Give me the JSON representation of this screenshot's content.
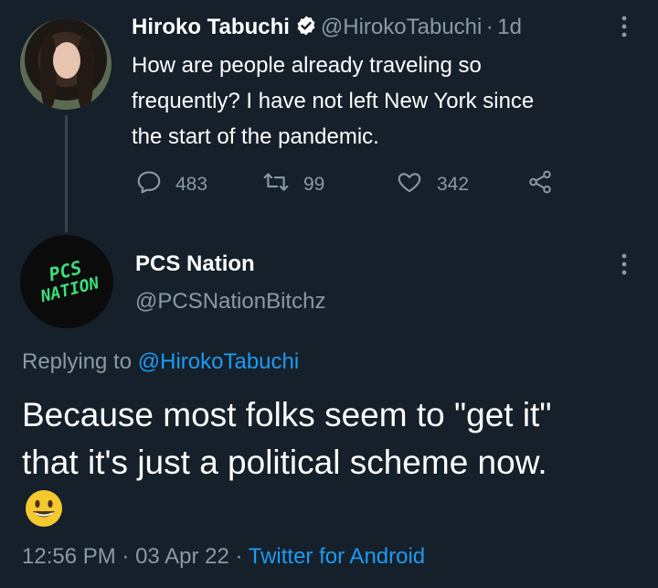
{
  "parent_tweet": {
    "display_name": "Hiroko Tabuchi",
    "handle": "@HirokoTabuchi",
    "separator": "·",
    "time_ago": "1d",
    "text_lines": [
      "How are people already traveling so",
      "frequently? I have not left New York since",
      "the start of the pandemic."
    ],
    "replies": "483",
    "retweets": "99",
    "likes": "342",
    "icons": [
      "verified-badge-icon",
      "reply-icon",
      "retweet-icon",
      "like-icon",
      "share-icon",
      "more-icon"
    ]
  },
  "reply_tweet": {
    "display_name": "PCS Nation",
    "handle": "@PCSNationBitchz",
    "avatar_logo_lines": [
      "PCS",
      "NATION"
    ],
    "replying_prefix": "Replying to",
    "replying_handle": "@HirokoTabuchi",
    "text_lines": [
      "Because most folks seem to \"get it\"",
      "that it's just a political scheme now."
    ],
    "emoji": "grinning-face-emoji",
    "time": "12:56 PM",
    "date_sep": "·",
    "date": "03 Apr 22",
    "source_sep": "·",
    "source": "Twitter for Android"
  },
  "colors": {
    "background": "#15202b",
    "muted": "#8b98a5",
    "link": "#1d9bf0",
    "logo_green": "#39e07a"
  }
}
